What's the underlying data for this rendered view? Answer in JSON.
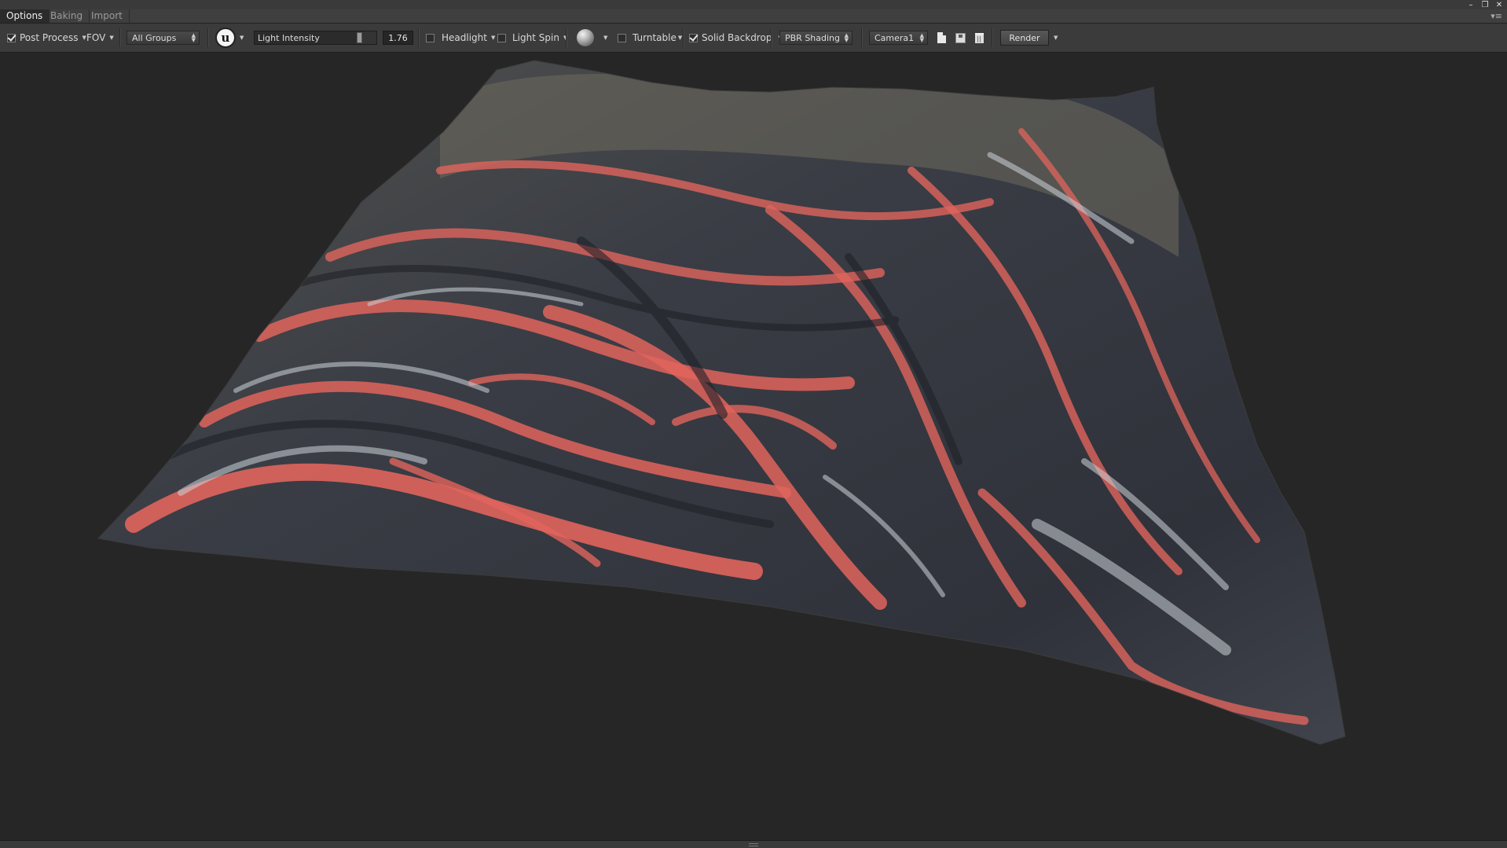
{
  "tabs": [
    {
      "label": "Options",
      "active": true
    },
    {
      "label": "Baking",
      "active": false
    },
    {
      "label": "Import",
      "active": false
    }
  ],
  "toolbar": {
    "post_process": {
      "label": "Post Process",
      "checked": true
    },
    "fov": {
      "label": "FOV"
    },
    "groups": {
      "selected": "All Groups"
    },
    "light_intensity": {
      "label": "Light Intensity",
      "value": "1.76",
      "fraction": 0.85
    },
    "headlight": {
      "label": "Headlight",
      "checked": false
    },
    "light_spin": {
      "label": "Light Spin",
      "checked": false
    },
    "turntable": {
      "label": "Turntable",
      "checked": false
    },
    "solid_backdrop": {
      "label": "Solid Backdrop",
      "checked": true
    },
    "shading": {
      "selected": "PBR Shading"
    },
    "camera": {
      "selected": "Camera1"
    },
    "render": {
      "label": "Render"
    }
  },
  "colors": {
    "background": "#262626",
    "terrain_rock": "#3a3d45",
    "terrain_highlight": "#cdd3da",
    "terrain_sediment": "#e0645c",
    "terrain_moss": "#6d6a5c"
  },
  "icons": {
    "unreal": "unreal-logo-icon",
    "sphere": "material-sphere-icon",
    "new": "new-document-icon",
    "save": "save-icon",
    "delete": "trash-icon"
  }
}
